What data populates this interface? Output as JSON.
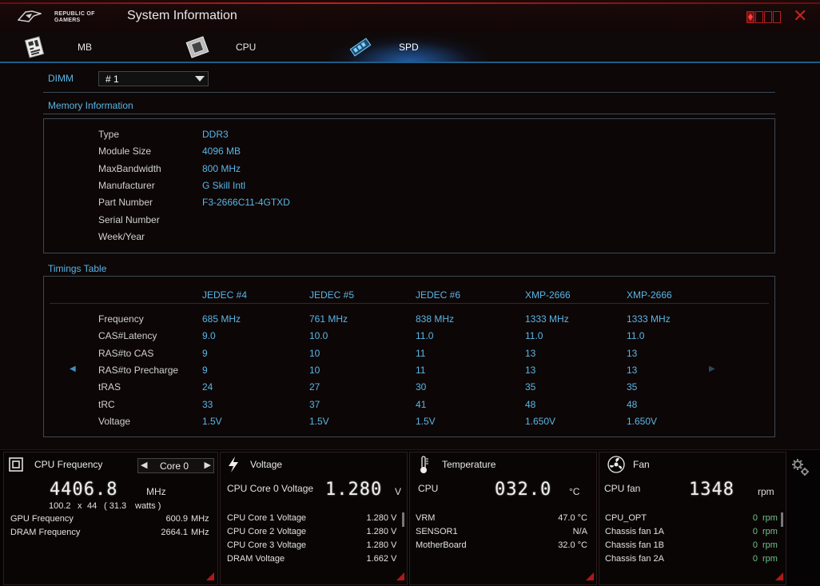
{
  "app": {
    "brand_line1": "REPUBLIC OF",
    "brand_line2": "GAMERS",
    "title": "System Information"
  },
  "tabs": [
    {
      "label": "MB",
      "icon": "motherboard-icon"
    },
    {
      "label": "CPU",
      "icon": "cpu-chip-icon"
    },
    {
      "label": "SPD",
      "icon": "memory-stick-icon",
      "active": true
    }
  ],
  "dimm": {
    "label": "DIMM",
    "selected": "# 1"
  },
  "memory_info": {
    "title": "Memory Information",
    "rows": [
      {
        "label": "Type",
        "value": "DDR3"
      },
      {
        "label": "Module Size",
        "value": "4096 MB"
      },
      {
        "label": "MaxBandwidth",
        "value": "800 MHz"
      },
      {
        "label": "Manufacturer",
        "value": "G Skill Intl"
      },
      {
        "label": "Part Number",
        "value": "F3-2666C11-4GTXD"
      },
      {
        "label": "Serial Number",
        "value": ""
      },
      {
        "label": "Week/Year",
        "value": ""
      }
    ]
  },
  "timings": {
    "title": "Timings Table",
    "columns": [
      "JEDEC #4",
      "JEDEC #5",
      "JEDEC #6",
      "XMP-2666",
      "XMP-2666"
    ],
    "rows": [
      {
        "label": "Frequency",
        "values": [
          "685 MHz",
          "761 MHz",
          "838 MHz",
          "1333 MHz",
          "1333 MHz"
        ]
      },
      {
        "label": "CAS#Latency",
        "values": [
          "9.0",
          "10.0",
          "11.0",
          "11.0",
          "11.0"
        ]
      },
      {
        "label": "RAS#to CAS",
        "values": [
          "9",
          "10",
          "11",
          "13",
          "13"
        ]
      },
      {
        "label": "RAS#to Precharge",
        "values": [
          "9",
          "10",
          "11",
          "13",
          "13"
        ]
      },
      {
        "label": "tRAS",
        "values": [
          "24",
          "27",
          "30",
          "35",
          "35"
        ]
      },
      {
        "label": "tRC",
        "values": [
          "33",
          "37",
          "41",
          "48",
          "48"
        ]
      },
      {
        "label": "Voltage",
        "values": [
          "1.5V",
          "1.5V",
          "1.5V",
          "1.650V",
          "1.650V"
        ]
      }
    ]
  },
  "monitor": {
    "cpu_freq": {
      "title": "CPU Frequency",
      "core_select": "Core 0",
      "value": "4406.8",
      "unit": "MHz",
      "detail_a": "100.2",
      "detail_x": "x",
      "detail_b": "44",
      "detail_c": "( 31.3",
      "detail_d": "watts )",
      "rows": [
        {
          "label": "GPU Frequency",
          "value": "600.9",
          "unit": "MHz"
        },
        {
          "label": "DRAM Frequency",
          "value": "2664.1",
          "unit": "MHz"
        }
      ]
    },
    "voltage": {
      "title": "Voltage",
      "main_label": "CPU Core 0 Voltage",
      "value": "1.280",
      "unit": "V",
      "rows": [
        {
          "label": "CPU Core 1 Voltage",
          "value": "1.280",
          "unit": "V"
        },
        {
          "label": "CPU Core 2 Voltage",
          "value": "1.280",
          "unit": "V"
        },
        {
          "label": "CPU Core 3 Voltage",
          "value": "1.280",
          "unit": "V"
        },
        {
          "label": "DRAM Voltage",
          "value": "1.662",
          "unit": "V"
        }
      ]
    },
    "temperature": {
      "title": "Temperature",
      "main_label": "CPU",
      "value": "032.0",
      "unit": "°C",
      "rows": [
        {
          "label": "VRM",
          "value": "47.0 °C"
        },
        {
          "label": "SENSOR1",
          "value": "N/A"
        },
        {
          "label": "MotherBoard",
          "value": "32.0 °C"
        }
      ]
    },
    "fan": {
      "title": "Fan",
      "main_label": "CPU fan",
      "value": "1348",
      "unit": "rpm",
      "rows": [
        {
          "label": "CPU_OPT",
          "value": "0",
          "unit": "rpm"
        },
        {
          "label": "Chassis fan 1A",
          "value": "0",
          "unit": "rpm"
        },
        {
          "label": "Chassis fan 1B",
          "value": "0",
          "unit": "rpm"
        },
        {
          "label": "Chassis fan 2A",
          "value": "0",
          "unit": "rpm"
        }
      ]
    }
  },
  "colors": {
    "accent_blue": "#59b6e6",
    "accent_red": "#c31d1d",
    "rpm_green": "#6ec48c"
  }
}
